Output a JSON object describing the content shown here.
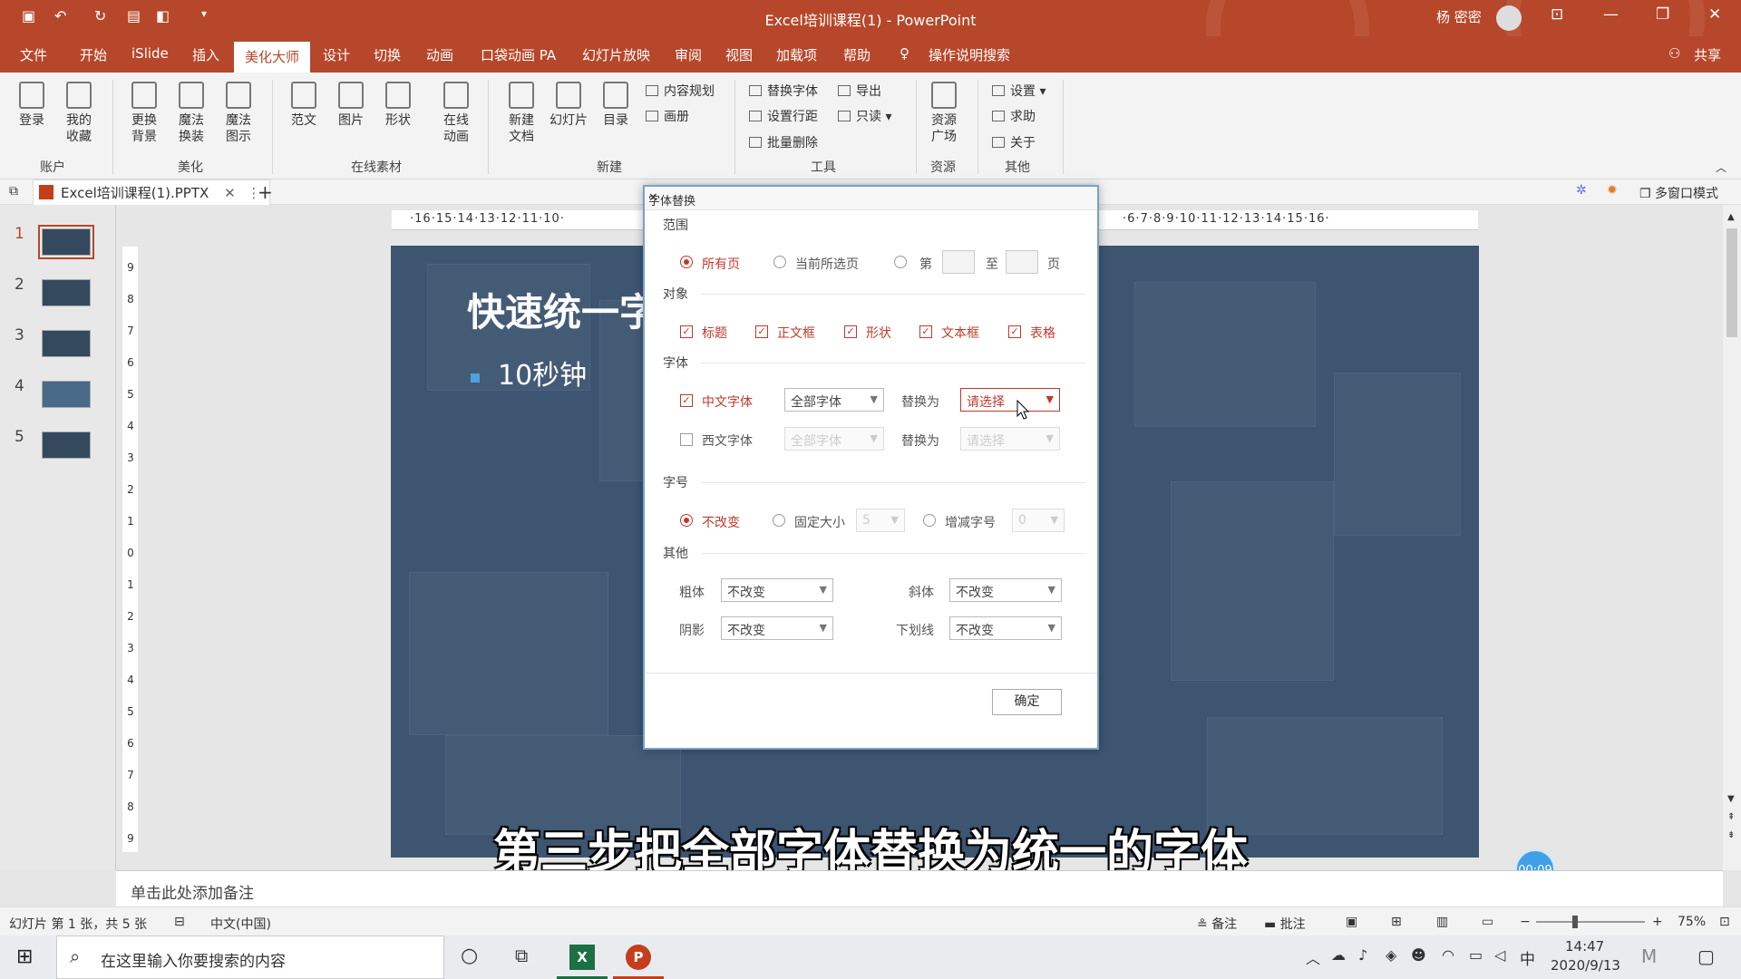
{
  "titlebar": {
    "title": "Excel培训课程(1) - PowerPoint",
    "user": "杨 密密",
    "colors": {
      "accent": "#b7472a"
    }
  },
  "menu": {
    "tabs": [
      "文件",
      "开始",
      "iSlide",
      "插入",
      "美化大师",
      "设计",
      "切换",
      "动画",
      "口袋动画 PA",
      "幻灯片放映",
      "审阅",
      "视图",
      "加载项",
      "帮助"
    ],
    "active_index": 4,
    "search": "操作说明搜索",
    "share": "共享"
  },
  "ribbon": {
    "account": {
      "login": "登录",
      "fav1": "我的",
      "fav2": "收藏",
      "group": "账户"
    },
    "beautify": {
      "b1a": "更换",
      "b1b": "背景",
      "b2a": "魔法",
      "b2b": "换装",
      "b3a": "魔法",
      "b3b": "图示",
      "group": "美化"
    },
    "online": {
      "fanwen": "范文",
      "tupian": "图片",
      "xingzhuang": "形状",
      "dh1": "在线",
      "dh2": "动画",
      "group": "在线素材"
    },
    "new": {
      "n1a": "新建",
      "n1b": "文档",
      "slides": "幻灯片",
      "toc": "目录",
      "plan": "内容规划",
      "album": "画册",
      "group": "新建"
    },
    "tools": {
      "replace_font": "替换字体",
      "export": "导出",
      "line_spacing": "设置行距",
      "readonly": "只读",
      "batch_delete": "批量删除",
      "group": "工具"
    },
    "resources": {
      "r1": "资源",
      "r2": "广场",
      "group": "资源"
    },
    "other": {
      "settings": "设置",
      "help": "求助",
      "about": "关于",
      "group": "其他"
    }
  },
  "docbar": {
    "file_tab": "Excel培训课程(1).PPTX",
    "multi_window": "多窗口模式"
  },
  "thumbnails": [
    "1",
    "2",
    "3",
    "4",
    "5"
  ],
  "ruler": {
    "h_left": [
      "16",
      "15",
      "14",
      "13",
      "12",
      "11",
      "10"
    ],
    "h_right": [
      "6",
      "7",
      "8",
      "9",
      "10",
      "11",
      "12",
      "13",
      "14",
      "15",
      "16"
    ],
    "v": [
      "9",
      "8",
      "7",
      "6",
      "5",
      "4",
      "3",
      "2",
      "1",
      "0",
      "1",
      "2",
      "3",
      "4",
      "5",
      "6",
      "7",
      "8",
      "9"
    ]
  },
  "slide": {
    "title": "快速统一字",
    "bullet": "10秒钟"
  },
  "dialog": {
    "title": "字体替换",
    "range": {
      "label": "范围",
      "all": "所有页",
      "current": "当前所选页",
      "page_prefix": "第",
      "to": "至",
      "page_suffix": "页"
    },
    "objects": {
      "label": "对象",
      "title": "标题",
      "body": "正文框",
      "shape": "形状",
      "textbox": "文本框",
      "table": "表格"
    },
    "font": {
      "label": "字体",
      "cn": "中文字体",
      "cn_value": "全部字体",
      "replace_with": "替换为",
      "cn_target": "请选择",
      "west": "西文字体",
      "west_value": "全部字体",
      "west_target": "请选择"
    },
    "size": {
      "label": "字号",
      "unchanged": "不改变",
      "fixed": "固定大小",
      "fixed_value": "5",
      "increment": "增减字号",
      "increment_value": "0"
    },
    "other": {
      "label": "其他",
      "bold": "粗体",
      "bold_value": "不改变",
      "italic": "斜体",
      "italic_value": "不改变",
      "shadow": "阴影",
      "shadow_value": "不改变",
      "underline": "下划线",
      "underline_value": "不改变"
    },
    "ok": "确定"
  },
  "subtitle": "第三步把全部字体替换为统一的字体",
  "timer": "00:09",
  "notes": "单击此处添加备注",
  "status": {
    "slide_info": "幻灯片 第 1 张，共 5 张",
    "language": "中文(中国)",
    "notes": "备注",
    "comments": "批注",
    "zoom": "75%"
  },
  "taskbar": {
    "search": "在这里输入你要搜索的内容",
    "time": "14:47",
    "date": "2020/9/13",
    "ime": "中"
  }
}
